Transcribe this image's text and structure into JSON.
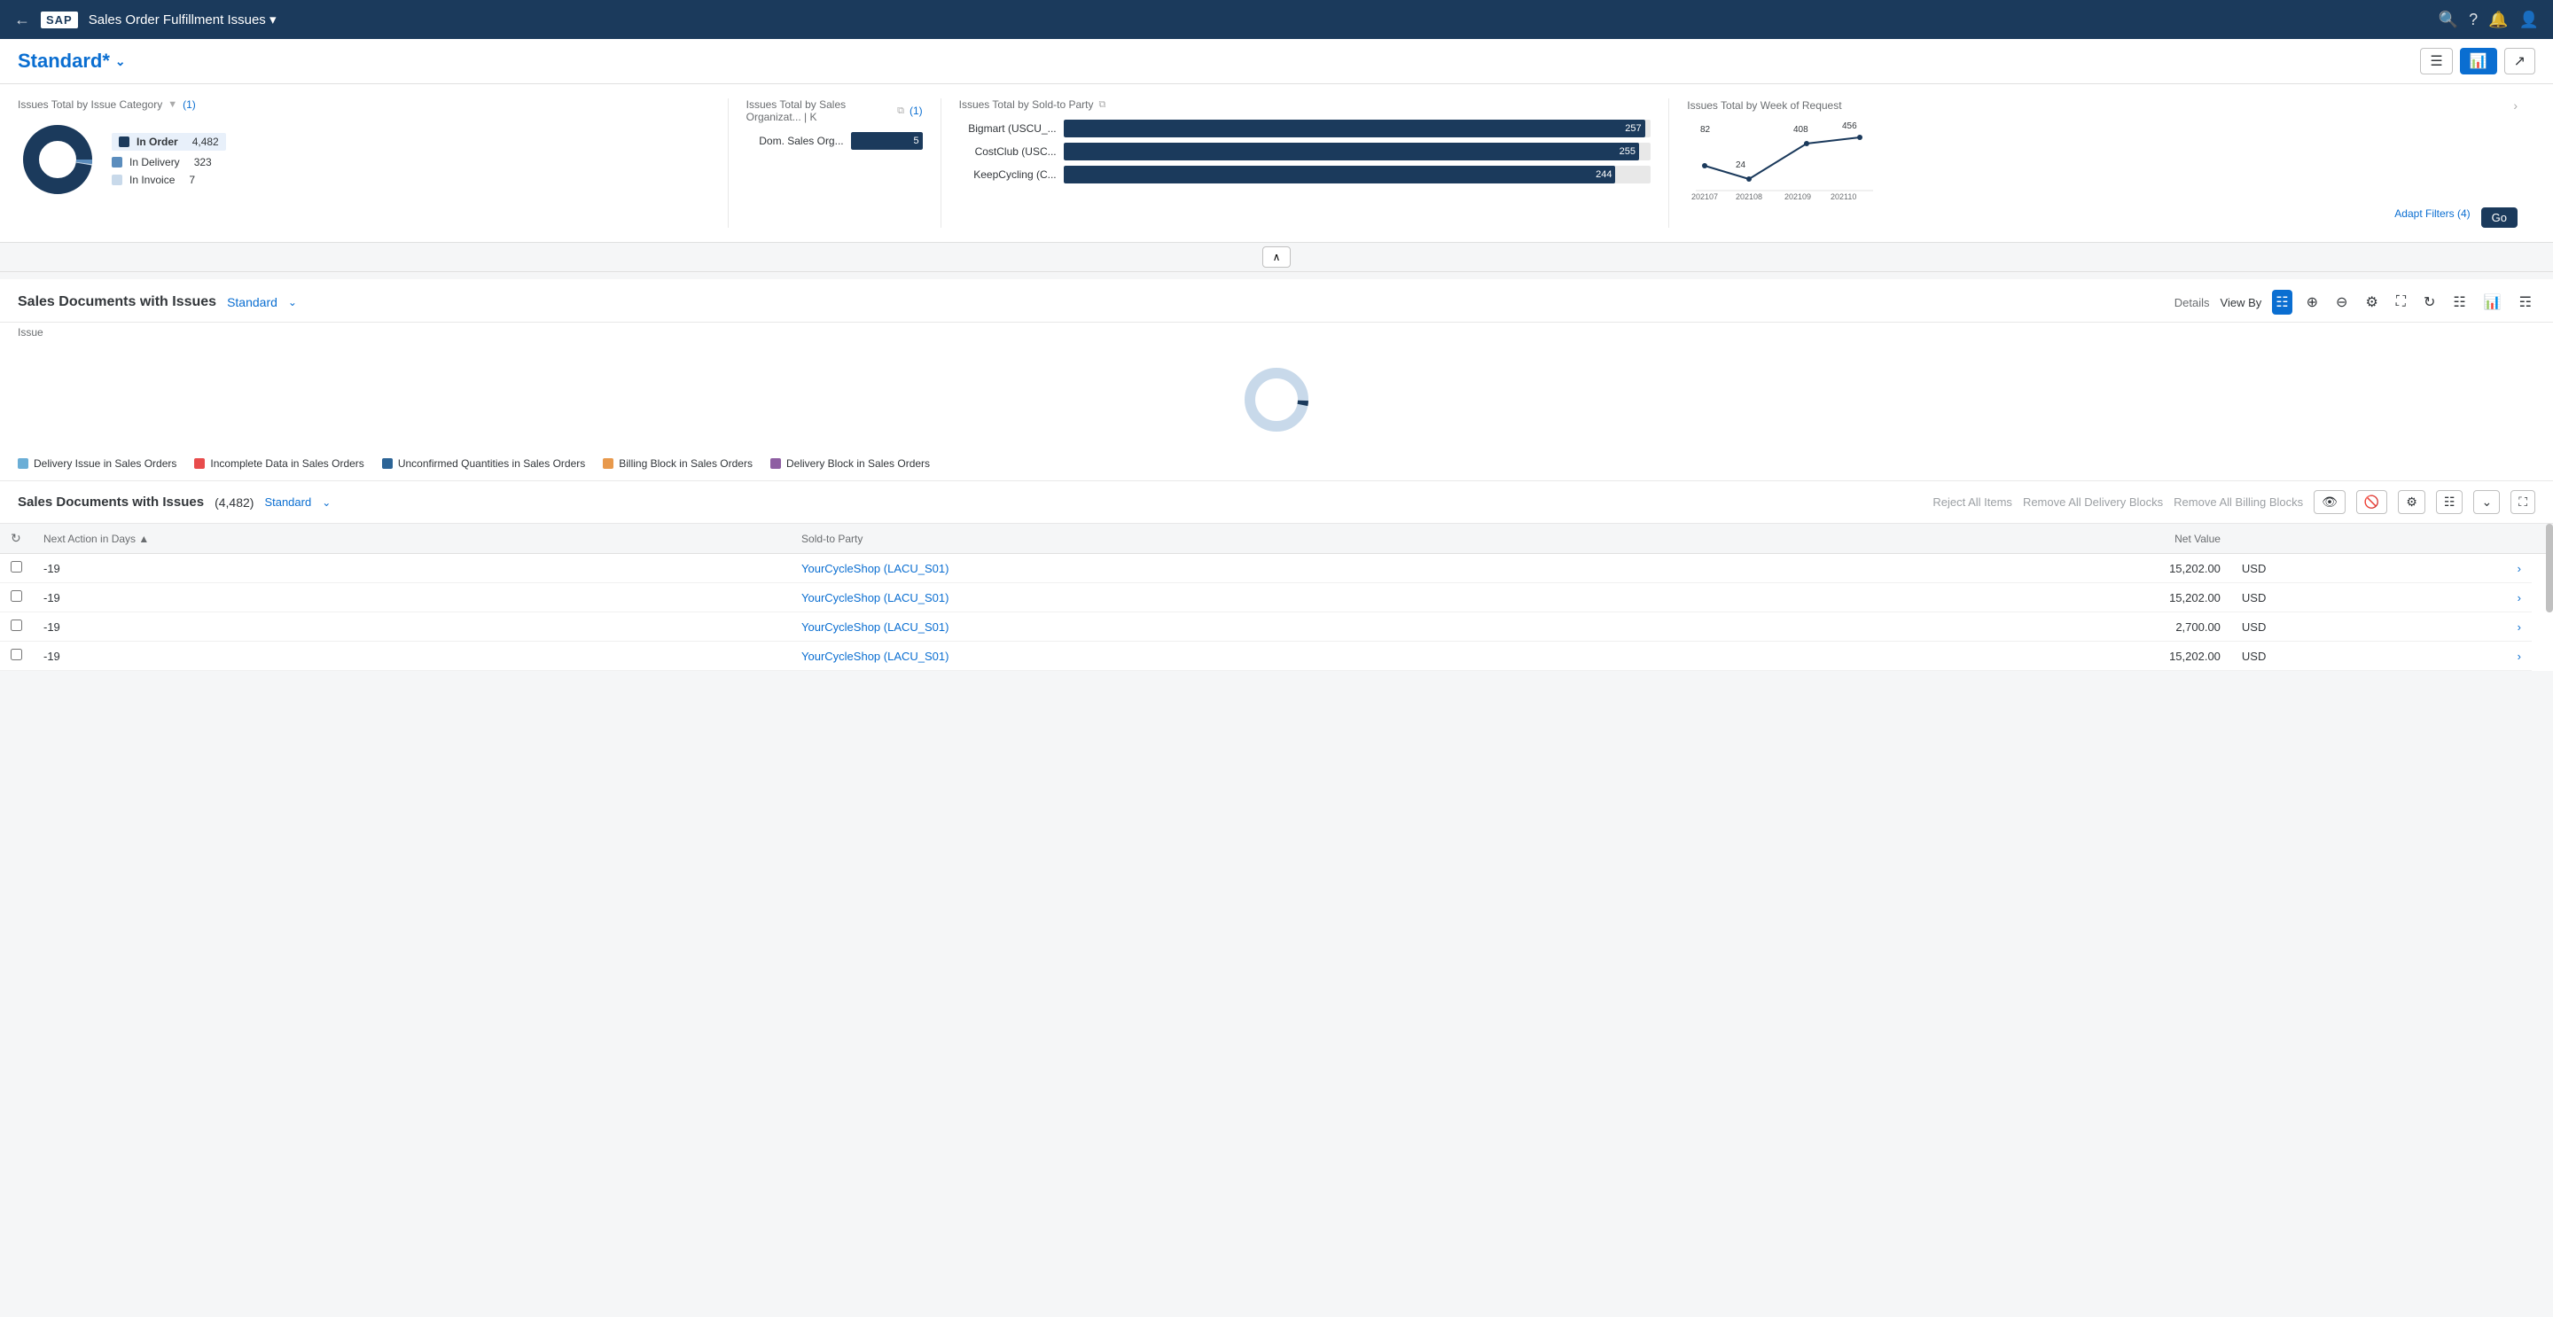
{
  "header": {
    "back_label": "←",
    "logo": "SAP",
    "title": "Sales Order Fulfillment Issues ▾",
    "icons": [
      "🔍",
      "?",
      "🔔",
      "👤"
    ]
  },
  "top_bar": {
    "view_title": "Standard*",
    "view_title_chevron": "⌄",
    "actions": [
      {
        "label": "≡",
        "active": false
      },
      {
        "label": "📊",
        "active": true
      },
      {
        "label": "↗",
        "active": false
      }
    ]
  },
  "charts": {
    "card1": {
      "title": "Issues Total by Issue Category",
      "filter_label": "(1)",
      "legend": [
        {
          "color": "#1b3a5c",
          "label": "In Order",
          "value": "4,482",
          "highlight": true
        },
        {
          "color": "#5b8dbd",
          "label": "In Delivery",
          "value": "323",
          "highlight": false
        },
        {
          "color": "#c8d9ea",
          "label": "In Invoice",
          "value": "7",
          "highlight": false
        }
      ],
      "donut": {
        "total": 4812,
        "segments": [
          {
            "value": 4482,
            "color": "#1b3a5c"
          },
          {
            "value": 323,
            "color": "#5b8dbd"
          },
          {
            "value": 7,
            "color": "#c8d9ea"
          }
        ]
      }
    },
    "card2": {
      "title": "Issues Total by Sales Organizat... | K",
      "filter_label": "(1)",
      "bars": [
        {
          "label": "Dom. Sales Org...",
          "value": 5,
          "max": 5,
          "color": "#1b3a5c"
        }
      ]
    },
    "card3": {
      "title": "Issues Total by Sold-to Party",
      "bars": [
        {
          "label": "Bigmart (USCU_...",
          "value": 257,
          "max": 260,
          "color": "#1b3a5c"
        },
        {
          "label": "CostClub (USC...",
          "value": 255,
          "max": 260,
          "color": "#1b3a5c"
        },
        {
          "label": "KeepCycling (C...",
          "value": 244,
          "max": 260,
          "color": "#1b3a5c"
        }
      ]
    },
    "card4": {
      "title": "Issues Total by Week of Request",
      "points": [
        {
          "x": 0,
          "y": 60,
          "label": "202107",
          "value": 82
        },
        {
          "x": 1,
          "y": 75,
          "label": "202108",
          "value": 24
        },
        {
          "x": 2,
          "y": 30,
          "label": "202109",
          "value": 408
        },
        {
          "x": 3,
          "y": 10,
          "label": "202110",
          "value": 456
        }
      ],
      "values": [
        82,
        24,
        408,
        456
      ],
      "labels": [
        "202107",
        "202108",
        "202109",
        "202110"
      ]
    }
  },
  "sales_docs_section": {
    "title": "Sales Documents with Issues",
    "view_label": "Standard",
    "view_chevron": "⌄",
    "details_label": "Details",
    "view_by_label": "View By",
    "issue_label": "Issue",
    "toolbar_icons": [
      "table",
      "zoom-in",
      "zoom-out",
      "settings",
      "fullscreen",
      "refresh",
      "grid1",
      "chart",
      "grid2"
    ]
  },
  "table_section": {
    "title": "Sales Documents with Issues",
    "count": "(4,482)",
    "view_label": "Standard",
    "view_chevron": "⌄",
    "actions": {
      "reject_all": "Reject All Items",
      "remove_delivery": "Remove All Delivery Blocks",
      "remove_billing": "Remove All Billing Blocks"
    },
    "columns": [
      {
        "label": "",
        "type": "checkbox"
      },
      {
        "label": "Next Action in Days",
        "sortable": true
      },
      {
        "label": "Sold-to Party"
      },
      {
        "label": "Net Value",
        "align": "right"
      },
      {
        "label": ""
      },
      {
        "label": ""
      }
    ],
    "rows": [
      {
        "next_action": "-19",
        "sold_to": "YourCycleShop (LACU_S01)",
        "net_value": "15,202.00",
        "currency": "USD"
      },
      {
        "next_action": "-19",
        "sold_to": "YourCycleShop (LACU_S01)",
        "net_value": "15,202.00",
        "currency": "USD"
      },
      {
        "next_action": "-19",
        "sold_to": "YourCycleShop (LACU_S01)",
        "net_value": "2,700.00",
        "currency": "USD"
      },
      {
        "next_action": "-19",
        "sold_to": "YourCycleShop (LACU_S01)",
        "net_value": "15,202.00",
        "currency": "USD"
      }
    ]
  },
  "chart_legend": {
    "items": [
      {
        "color": "#6baed6",
        "label": "Delivery Issue in Sales Orders"
      },
      {
        "color": "#e84c4c",
        "label": "Incomplete Data in Sales Orders"
      },
      {
        "color": "#2c6496",
        "label": "Unconfirmed Quantities in Sales Orders"
      },
      {
        "color": "#e8994c",
        "label": "Billing Block in Sales Orders"
      },
      {
        "color": "#8e5ea2",
        "label": "Delivery Block in Sales Orders"
      }
    ]
  },
  "donut_center": {
    "loading": true
  }
}
